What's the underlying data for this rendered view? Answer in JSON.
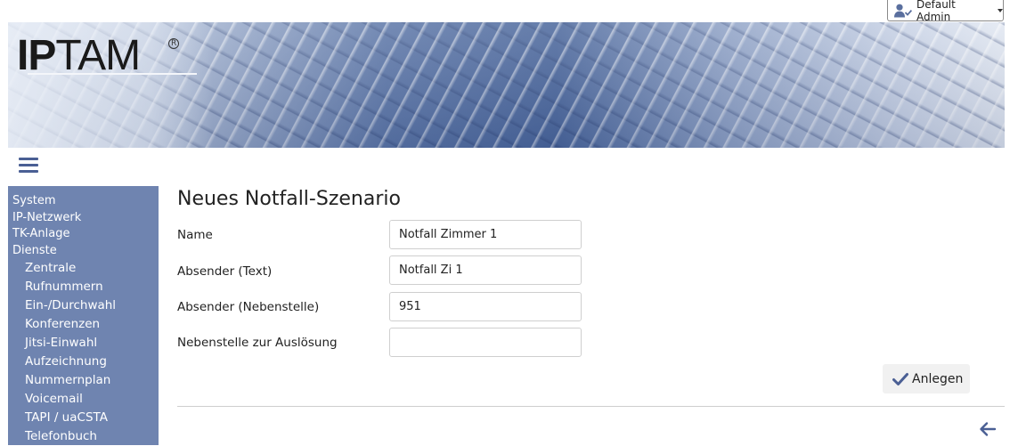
{
  "user_menu": {
    "label": "Default Admin",
    "icon": "user-check-icon"
  },
  "banner": {
    "logo_text_bold": "IP",
    "logo_text_rest": "TAM",
    "logo_mark": "R"
  },
  "sidebar": {
    "items": [
      {
        "label": "System"
      },
      {
        "label": "IP-Netzwerk"
      },
      {
        "label": "TK-Anlage"
      },
      {
        "label": "Dienste"
      }
    ],
    "subitems": [
      {
        "label": "Zentrale"
      },
      {
        "label": "Rufnummern"
      },
      {
        "label": "Ein-/Durchwahl"
      },
      {
        "label": "Konferenzen"
      },
      {
        "label": "Jitsi-Einwahl"
      },
      {
        "label": "Aufzeichnung"
      },
      {
        "label": "Nummernplan"
      },
      {
        "label": "Voicemail"
      },
      {
        "label": "TAPI / uaCSTA"
      },
      {
        "label": "Telefonbuch"
      }
    ]
  },
  "page": {
    "title": "Neues Notfall-Szenario"
  },
  "form": {
    "name_label": "Name",
    "name_value": "Notfall Zimmer 1",
    "sender_text_label": "Absender (Text)",
    "sender_text_value": "Notfall Zi 1",
    "sender_ext_label": "Absender (Nebenstelle)",
    "sender_ext_value": "951",
    "trigger_ext_label": "Nebenstelle zur Auslösung",
    "trigger_ext_value": ""
  },
  "actions": {
    "create_label": "Anlegen"
  },
  "colors": {
    "sidebar_bg": "#6f84b0",
    "accent": "#4a5f94"
  }
}
